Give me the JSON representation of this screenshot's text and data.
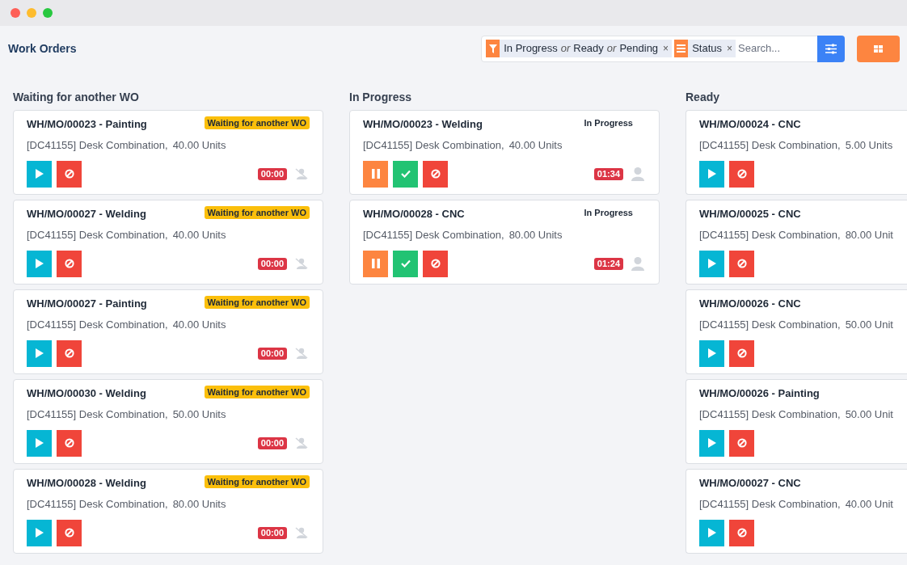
{
  "header": {
    "title": "Work Orders",
    "filters": [
      {
        "kind": "filter",
        "parts": [
          "In Progress",
          "or",
          "Ready",
          "or",
          "Pending"
        ],
        "remove": "×"
      },
      {
        "kind": "group",
        "parts": [
          "Status"
        ],
        "remove": "×"
      }
    ],
    "search": {
      "placeholder": "Search..."
    }
  },
  "columns": [
    {
      "title": "Waiting for another WO",
      "cards": [
        {
          "title": "WH/MO/00023 - Painting",
          "product": "[DC41155] Desk Combination,",
          "quantity": "40.00 Units",
          "badge": {
            "kind": "waiting",
            "text": "Waiting for another WO"
          },
          "actions": [
            {
              "kind": "start"
            },
            {
              "kind": "block"
            }
          ],
          "timer": "00:00",
          "assignee": {
            "kind": "none"
          }
        },
        {
          "title": "WH/MO/00027 - Welding",
          "product": "[DC41155] Desk Combination,",
          "quantity": "40.00 Units",
          "badge": {
            "kind": "waiting",
            "text": "Waiting for another WO"
          },
          "actions": [
            {
              "kind": "start"
            },
            {
              "kind": "block"
            }
          ],
          "timer": "00:00",
          "assignee": {
            "kind": "none"
          }
        },
        {
          "title": "WH/MO/00027 - Painting",
          "product": "[DC41155] Desk Combination,",
          "quantity": "40.00 Units",
          "badge": {
            "kind": "waiting",
            "text": "Waiting for another WO"
          },
          "actions": [
            {
              "kind": "start"
            },
            {
              "kind": "block"
            }
          ],
          "timer": "00:00",
          "assignee": {
            "kind": "none"
          }
        },
        {
          "title": "WH/MO/00030 - Welding",
          "product": "[DC41155] Desk Combination,",
          "quantity": "50.00 Units",
          "badge": {
            "kind": "waiting",
            "text": "Waiting for another WO"
          },
          "actions": [
            {
              "kind": "start"
            },
            {
              "kind": "block"
            }
          ],
          "timer": "00:00",
          "assignee": {
            "kind": "none"
          }
        },
        {
          "title": "WH/MO/00028 - Welding",
          "product": "[DC41155] Desk Combination,",
          "quantity": "80.00 Units",
          "badge": {
            "kind": "waiting",
            "text": "Waiting for another WO"
          },
          "actions": [
            {
              "kind": "start"
            },
            {
              "kind": "block"
            }
          ],
          "timer": "00:00",
          "assignee": {
            "kind": "none"
          }
        }
      ]
    },
    {
      "title": "In Progress",
      "cards": [
        {
          "title": "WH/MO/00023 - Welding",
          "product": "[DC41155] Desk Combination,",
          "quantity": "40.00 Units",
          "badge": {
            "kind": "progress",
            "text": "In Progress"
          },
          "actions": [
            {
              "kind": "pause"
            },
            {
              "kind": "done"
            },
            {
              "kind": "block"
            }
          ],
          "timer": "01:34",
          "assignee": {
            "kind": "user"
          }
        },
        {
          "title": "WH/MO/00028 - CNC",
          "product": "[DC41155] Desk Combination,",
          "quantity": "80.00 Units",
          "badge": {
            "kind": "progress",
            "text": "In Progress"
          },
          "actions": [
            {
              "kind": "pause"
            },
            {
              "kind": "done"
            },
            {
              "kind": "block"
            }
          ],
          "timer": "01:24",
          "assignee": {
            "kind": "user"
          }
        }
      ]
    },
    {
      "title": "Ready",
      "cards": [
        {
          "title": "WH/MO/00024 - CNC",
          "product": "[DC41155] Desk Combination,",
          "quantity": "5.00 Units",
          "actions": [
            {
              "kind": "start"
            },
            {
              "kind": "block"
            }
          ]
        },
        {
          "title": "WH/MO/00025 - CNC",
          "product": "[DC41155] Desk Combination,",
          "quantity": "80.00 Unit",
          "actions": [
            {
              "kind": "start"
            },
            {
              "kind": "block"
            }
          ]
        },
        {
          "title": "WH/MO/00026 - CNC",
          "product": "[DC41155] Desk Combination,",
          "quantity": "50.00 Unit",
          "actions": [
            {
              "kind": "start"
            },
            {
              "kind": "block"
            }
          ]
        },
        {
          "title": "WH/MO/00026 - Painting",
          "product": "[DC41155] Desk Combination,",
          "quantity": "50.00 Unit",
          "actions": [
            {
              "kind": "start"
            },
            {
              "kind": "block"
            }
          ]
        },
        {
          "title": "WH/MO/00027 - CNC",
          "product": "[DC41155] Desk Combination,",
          "quantity": "40.00 Unit",
          "actions": [
            {
              "kind": "start"
            },
            {
              "kind": "block"
            }
          ]
        }
      ]
    }
  ]
}
